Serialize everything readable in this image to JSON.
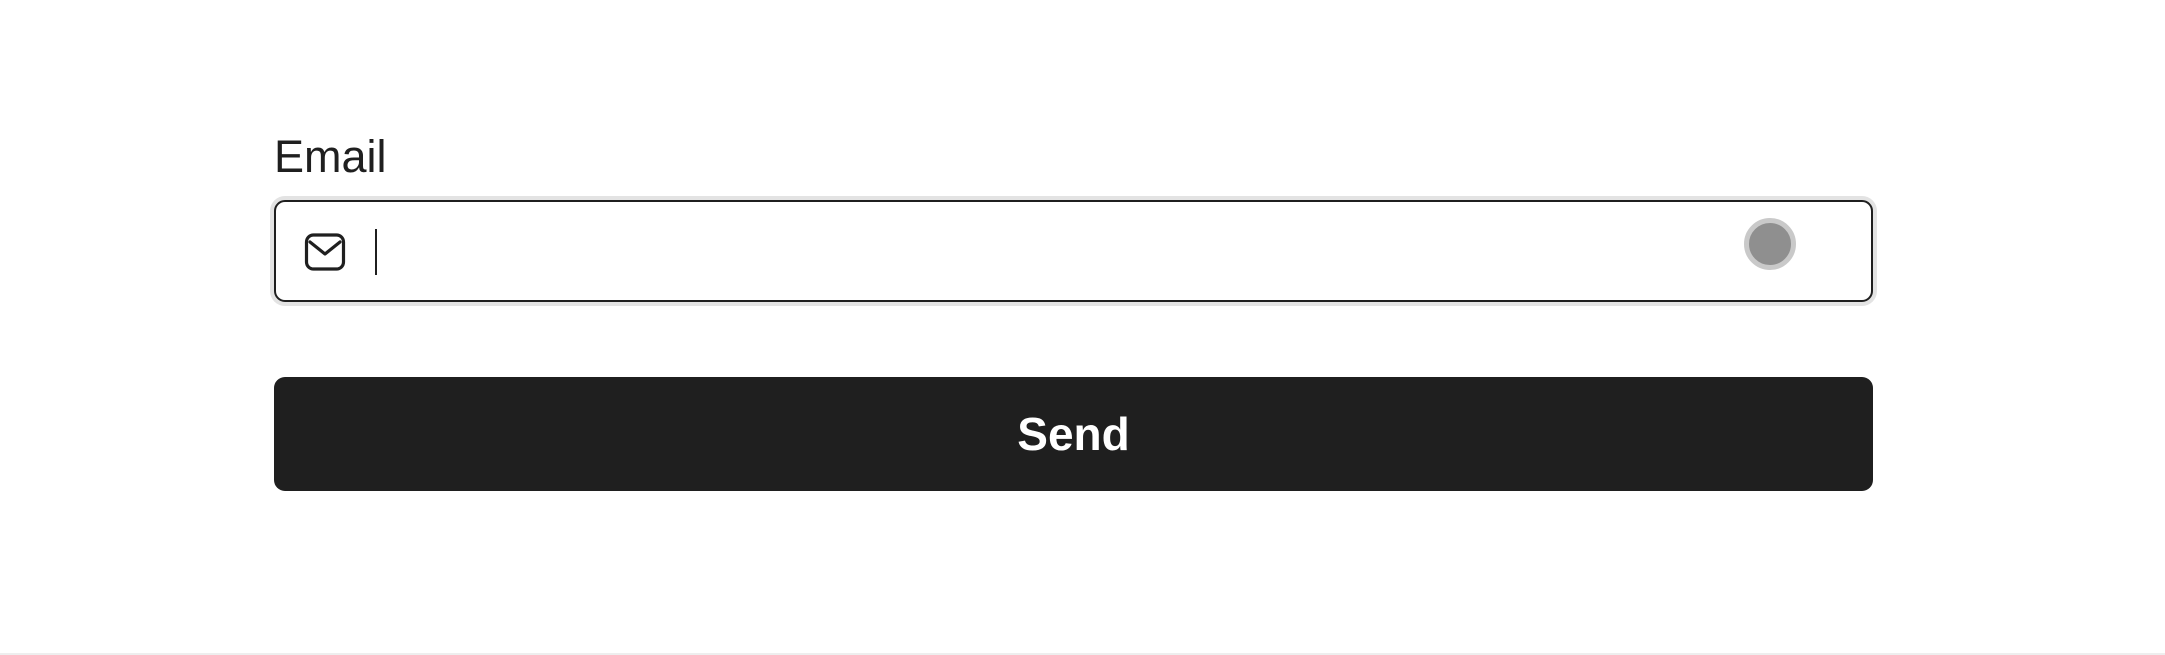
{
  "form": {
    "email_label": "Email",
    "email_value": "",
    "email_placeholder": "",
    "send_label": "Send"
  },
  "icons": {
    "field_icon": "mail-icon",
    "status_indicator": "status-dot"
  },
  "colors": {
    "primary": "#1f1f1f",
    "button_text": "#ffffff",
    "status_dot": "#8f8f8f",
    "status_dot_ring": "#c9c9c9",
    "focus_ring": "#e3e3e3"
  }
}
